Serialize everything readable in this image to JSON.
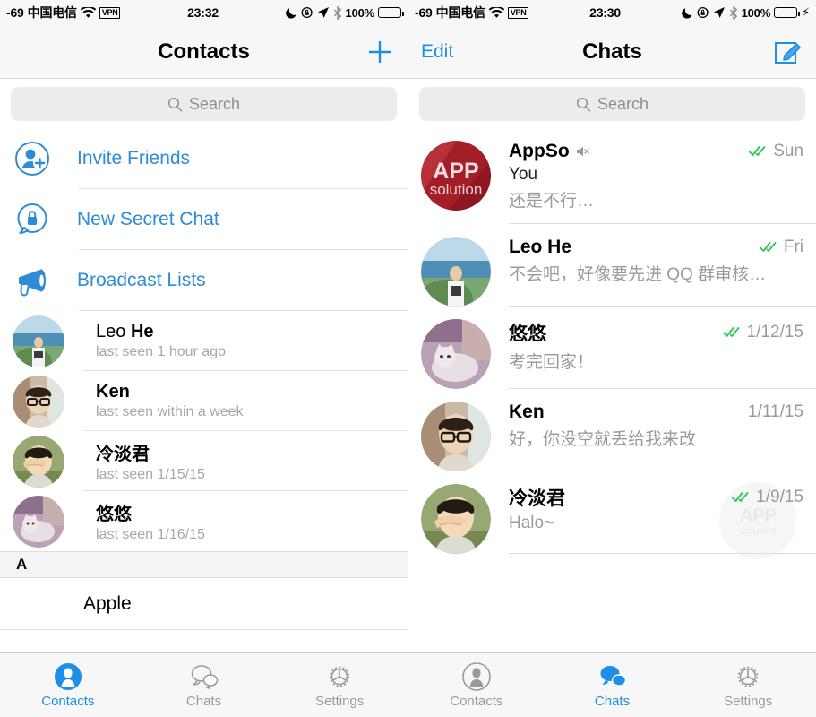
{
  "colors": {
    "accent": "#1d8fe8",
    "link": "#2e8bd8",
    "check_green": "#34c759",
    "appso_red": "#a41e28",
    "muted_text": "#9a9a9a"
  },
  "left_phone": {
    "status_bar": {
      "signal": "-69",
      "carrier": "中国电信",
      "vpn": "VPN",
      "time": "23:32",
      "battery_percent": "100%",
      "icons": [
        "wifi-icon",
        "vpn-badge",
        "moon-icon",
        "rotation-lock-icon",
        "location-arrow-icon",
        "bluetooth-icon",
        "battery-icon"
      ]
    },
    "nav": {
      "title": "Contacts",
      "right_action": "add-icon"
    },
    "search": {
      "placeholder": "Search"
    },
    "actions": [
      {
        "label": "Invite Friends",
        "icon": "add-person-icon"
      },
      {
        "label": "New Secret Chat",
        "icon": "lock-chat-icon"
      },
      {
        "label": "Broadcast Lists",
        "icon": "megaphone-icon"
      }
    ],
    "contacts": [
      {
        "name_plain": "Leo ",
        "name_bold": "He",
        "status": "last seen 1 hour ago",
        "avatar": "leo"
      },
      {
        "name_plain": "",
        "name_bold": "Ken",
        "status": "last seen within a week",
        "avatar": "ken"
      },
      {
        "name_plain": "",
        "name_bold": "冷淡君",
        "status": "last seen 1/15/15",
        "avatar": "leng"
      },
      {
        "name_plain": "",
        "name_bold": "悠悠",
        "status": "last seen 1/16/15",
        "avatar": "youyou"
      }
    ],
    "section_header": "A",
    "section_rows": [
      {
        "name": "Apple"
      }
    ],
    "tabs": [
      {
        "label": "Contacts",
        "icon": "person-icon",
        "active": true
      },
      {
        "label": "Chats",
        "icon": "chat-bubbles-icon",
        "active": false
      },
      {
        "label": "Settings",
        "icon": "gear-icon",
        "active": false
      }
    ]
  },
  "right_phone": {
    "status_bar": {
      "signal": "-69",
      "carrier": "中国电信",
      "vpn": "VPN",
      "time": "23:30",
      "battery_percent": "100%",
      "charging": true,
      "icons": [
        "wifi-icon",
        "vpn-badge",
        "moon-icon",
        "rotation-lock-icon",
        "location-arrow-icon",
        "bluetooth-icon",
        "battery-charging-icon"
      ]
    },
    "nav": {
      "left_action": "Edit",
      "title": "Chats",
      "right_action": "compose-icon"
    },
    "search": {
      "placeholder": "Search"
    },
    "chats": [
      {
        "name": "AppSo",
        "muted": true,
        "sender": "You",
        "message": "还是不行…",
        "time": "Sun",
        "read": true,
        "avatar": "appso"
      },
      {
        "name": "Leo He",
        "muted": false,
        "sender": "",
        "message": "不会吧，好像要先进 QQ 群审核…",
        "time": "Fri",
        "read": true,
        "avatar": "leo"
      },
      {
        "name": "悠悠",
        "muted": false,
        "sender": "",
        "message": "考完回家！",
        "time": "1/12/15",
        "read": true,
        "avatar": "youyou"
      },
      {
        "name": "Ken",
        "muted": false,
        "sender": "",
        "message": "好，你没空就丢给我来改",
        "time": "1/11/15",
        "read": false,
        "avatar": "ken"
      },
      {
        "name": "冷淡君",
        "muted": false,
        "sender": "",
        "message": "Halo~",
        "time": "1/9/15",
        "read": true,
        "avatar": "leng"
      }
    ],
    "watermark": {
      "line1": "APP",
      "line2": "solution"
    },
    "tabs": [
      {
        "label": "Contacts",
        "icon": "person-icon",
        "active": false
      },
      {
        "label": "Chats",
        "icon": "chat-bubbles-icon",
        "active": true
      },
      {
        "label": "Settings",
        "icon": "gear-icon",
        "active": false
      }
    ]
  }
}
